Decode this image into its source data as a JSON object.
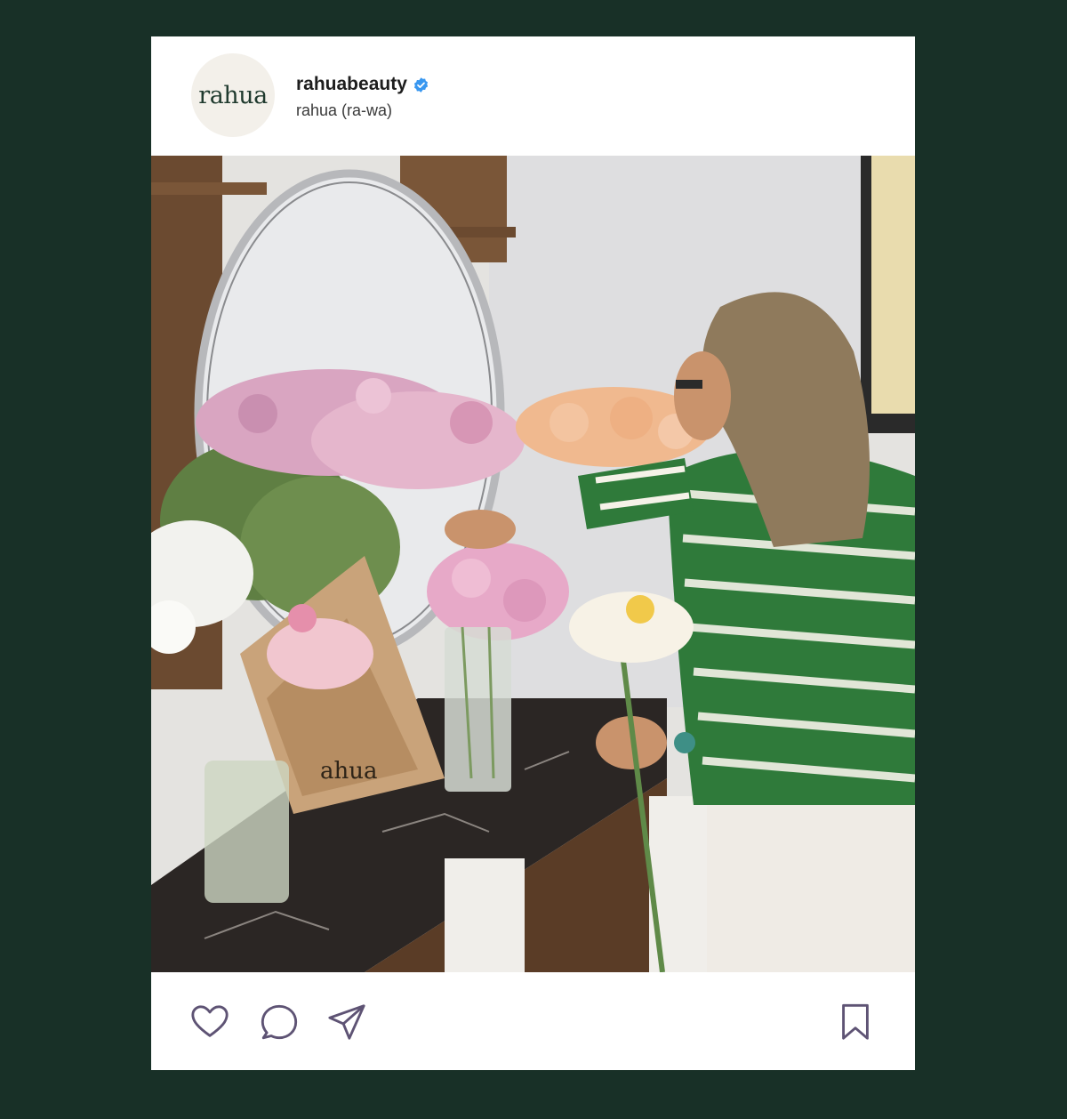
{
  "post": {
    "avatar_text": "rahua",
    "username": "rahuabeauty",
    "verified": true,
    "subtitle": "rahua (ra-wa)",
    "image_alt": "Florist arranging pink roses, peach roses and peonies in glass vases on a dark marble counter",
    "bag_print": "ahua"
  },
  "actions": {
    "icons": [
      "heart-icon",
      "comment-icon",
      "share-icon",
      "bookmark-icon"
    ]
  },
  "colors": {
    "background": "#183027",
    "card": "#ffffff",
    "icon_stroke": "#5e5374",
    "verified": "#3897f0"
  }
}
